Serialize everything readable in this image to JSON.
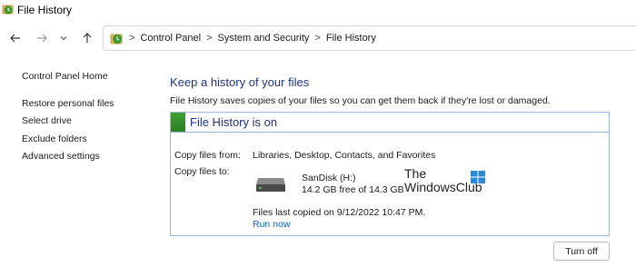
{
  "window": {
    "title": "File History"
  },
  "nav": {
    "back_icon": "back-arrow-icon",
    "forward_icon": "forward-arrow-icon",
    "recent_icon": "chevron-down-icon",
    "up_icon": "up-arrow-icon"
  },
  "breadcrumb": {
    "items": [
      "Control Panel",
      "System and Security",
      "File History"
    ],
    "separator": ">"
  },
  "sidebar": {
    "home": "Control Panel Home",
    "items": [
      {
        "label": "Restore personal files"
      },
      {
        "label": "Select drive"
      },
      {
        "label": "Exclude folders"
      },
      {
        "label": "Advanced settings"
      }
    ]
  },
  "main": {
    "heading": "Keep a history of your files",
    "description": "File History saves copies of your files so you can get them back if they're lost or damaged.",
    "status": {
      "title": "File History is on",
      "color": "#2e8b28"
    },
    "copy_from": {
      "label": "Copy files from:",
      "value": "Libraries, Desktop, Contacts, and Favorites"
    },
    "copy_to": {
      "label": "Copy files to:",
      "drive_name": "SanDisk (H:)",
      "drive_space": "14.2 GB free of 14.3 GB",
      "drive_icon": "drive-icon"
    },
    "last_copied": "Files last copied on 9/12/2022 10:47 PM.",
    "run_now": "Run now",
    "turn_off": "Turn off"
  },
  "watermark": {
    "line1": "The",
    "line2": "WindowsClub"
  },
  "colors": {
    "heading": "#1e3287",
    "link": "#0a64c8",
    "box_border": "#9bb8d8"
  }
}
